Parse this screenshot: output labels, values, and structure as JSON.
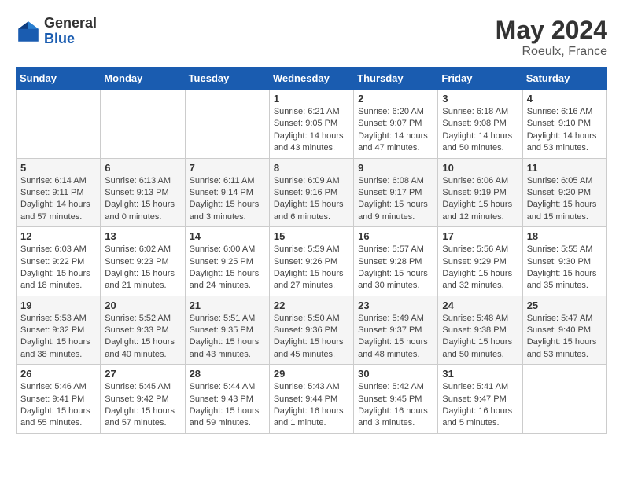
{
  "header": {
    "logo_general": "General",
    "logo_blue": "Blue",
    "month_year": "May 2024",
    "location": "Roeulx, France"
  },
  "weekdays": [
    "Sunday",
    "Monday",
    "Tuesday",
    "Wednesday",
    "Thursday",
    "Friday",
    "Saturday"
  ],
  "weeks": [
    [
      {
        "day": "",
        "info": ""
      },
      {
        "day": "",
        "info": ""
      },
      {
        "day": "",
        "info": ""
      },
      {
        "day": "1",
        "info": "Sunrise: 6:21 AM\nSunset: 9:05 PM\nDaylight: 14 hours\nand 43 minutes."
      },
      {
        "day": "2",
        "info": "Sunrise: 6:20 AM\nSunset: 9:07 PM\nDaylight: 14 hours\nand 47 minutes."
      },
      {
        "day": "3",
        "info": "Sunrise: 6:18 AM\nSunset: 9:08 PM\nDaylight: 14 hours\nand 50 minutes."
      },
      {
        "day": "4",
        "info": "Sunrise: 6:16 AM\nSunset: 9:10 PM\nDaylight: 14 hours\nand 53 minutes."
      }
    ],
    [
      {
        "day": "5",
        "info": "Sunrise: 6:14 AM\nSunset: 9:11 PM\nDaylight: 14 hours\nand 57 minutes."
      },
      {
        "day": "6",
        "info": "Sunrise: 6:13 AM\nSunset: 9:13 PM\nDaylight: 15 hours\nand 0 minutes."
      },
      {
        "day": "7",
        "info": "Sunrise: 6:11 AM\nSunset: 9:14 PM\nDaylight: 15 hours\nand 3 minutes."
      },
      {
        "day": "8",
        "info": "Sunrise: 6:09 AM\nSunset: 9:16 PM\nDaylight: 15 hours\nand 6 minutes."
      },
      {
        "day": "9",
        "info": "Sunrise: 6:08 AM\nSunset: 9:17 PM\nDaylight: 15 hours\nand 9 minutes."
      },
      {
        "day": "10",
        "info": "Sunrise: 6:06 AM\nSunset: 9:19 PM\nDaylight: 15 hours\nand 12 minutes."
      },
      {
        "day": "11",
        "info": "Sunrise: 6:05 AM\nSunset: 9:20 PM\nDaylight: 15 hours\nand 15 minutes."
      }
    ],
    [
      {
        "day": "12",
        "info": "Sunrise: 6:03 AM\nSunset: 9:22 PM\nDaylight: 15 hours\nand 18 minutes."
      },
      {
        "day": "13",
        "info": "Sunrise: 6:02 AM\nSunset: 9:23 PM\nDaylight: 15 hours\nand 21 minutes."
      },
      {
        "day": "14",
        "info": "Sunrise: 6:00 AM\nSunset: 9:25 PM\nDaylight: 15 hours\nand 24 minutes."
      },
      {
        "day": "15",
        "info": "Sunrise: 5:59 AM\nSunset: 9:26 PM\nDaylight: 15 hours\nand 27 minutes."
      },
      {
        "day": "16",
        "info": "Sunrise: 5:57 AM\nSunset: 9:28 PM\nDaylight: 15 hours\nand 30 minutes."
      },
      {
        "day": "17",
        "info": "Sunrise: 5:56 AM\nSunset: 9:29 PM\nDaylight: 15 hours\nand 32 minutes."
      },
      {
        "day": "18",
        "info": "Sunrise: 5:55 AM\nSunset: 9:30 PM\nDaylight: 15 hours\nand 35 minutes."
      }
    ],
    [
      {
        "day": "19",
        "info": "Sunrise: 5:53 AM\nSunset: 9:32 PM\nDaylight: 15 hours\nand 38 minutes."
      },
      {
        "day": "20",
        "info": "Sunrise: 5:52 AM\nSunset: 9:33 PM\nDaylight: 15 hours\nand 40 minutes."
      },
      {
        "day": "21",
        "info": "Sunrise: 5:51 AM\nSunset: 9:35 PM\nDaylight: 15 hours\nand 43 minutes."
      },
      {
        "day": "22",
        "info": "Sunrise: 5:50 AM\nSunset: 9:36 PM\nDaylight: 15 hours\nand 45 minutes."
      },
      {
        "day": "23",
        "info": "Sunrise: 5:49 AM\nSunset: 9:37 PM\nDaylight: 15 hours\nand 48 minutes."
      },
      {
        "day": "24",
        "info": "Sunrise: 5:48 AM\nSunset: 9:38 PM\nDaylight: 15 hours\nand 50 minutes."
      },
      {
        "day": "25",
        "info": "Sunrise: 5:47 AM\nSunset: 9:40 PM\nDaylight: 15 hours\nand 53 minutes."
      }
    ],
    [
      {
        "day": "26",
        "info": "Sunrise: 5:46 AM\nSunset: 9:41 PM\nDaylight: 15 hours\nand 55 minutes."
      },
      {
        "day": "27",
        "info": "Sunrise: 5:45 AM\nSunset: 9:42 PM\nDaylight: 15 hours\nand 57 minutes."
      },
      {
        "day": "28",
        "info": "Sunrise: 5:44 AM\nSunset: 9:43 PM\nDaylight: 15 hours\nand 59 minutes."
      },
      {
        "day": "29",
        "info": "Sunrise: 5:43 AM\nSunset: 9:44 PM\nDaylight: 16 hours\nand 1 minute."
      },
      {
        "day": "30",
        "info": "Sunrise: 5:42 AM\nSunset: 9:45 PM\nDaylight: 16 hours\nand 3 minutes."
      },
      {
        "day": "31",
        "info": "Sunrise: 5:41 AM\nSunset: 9:47 PM\nDaylight: 16 hours\nand 5 minutes."
      },
      {
        "day": "",
        "info": ""
      }
    ]
  ]
}
